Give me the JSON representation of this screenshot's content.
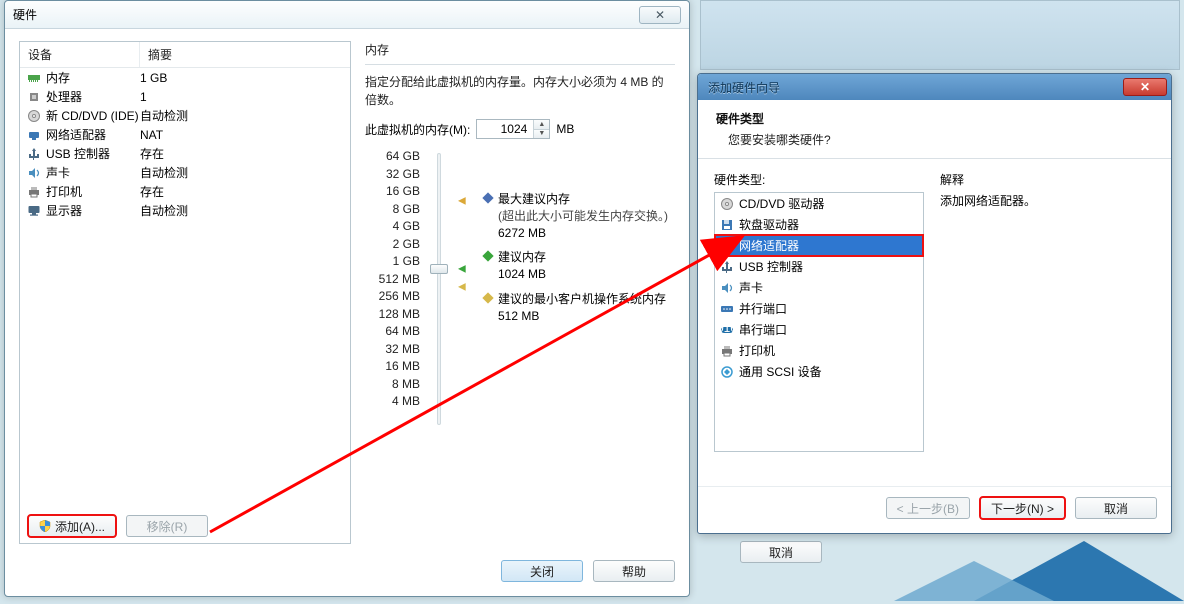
{
  "win1": {
    "title": "硬件",
    "close_x": "✕",
    "columns": {
      "device": "设备",
      "summary": "摘要"
    },
    "rows": [
      {
        "icon": "memory-icon",
        "dev": "内存",
        "sum": "1 GB"
      },
      {
        "icon": "cpu-icon",
        "dev": "处理器",
        "sum": "1"
      },
      {
        "icon": "cd-icon",
        "dev": "新 CD/DVD (IDE)",
        "sum": "自动检测"
      },
      {
        "icon": "network-icon",
        "dev": "网络适配器",
        "sum": "NAT"
      },
      {
        "icon": "usb-icon",
        "dev": "USB 控制器",
        "sum": "存在"
      },
      {
        "icon": "sound-icon",
        "dev": "声卡",
        "sum": "自动检测"
      },
      {
        "icon": "printer-icon",
        "dev": "打印机",
        "sum": "存在"
      },
      {
        "icon": "display-icon",
        "dev": "显示器",
        "sum": "自动检测"
      }
    ],
    "add_btn": "添加(A)...",
    "remove_btn": "移除(R)",
    "right": {
      "section": "内存",
      "desc": "指定分配给此虚拟机的内存量。内存大小必须为 4 MB 的倍数。",
      "field_label": "此虚拟机的内存(M):",
      "field_value": "1024",
      "field_unit": "MB",
      "ticks": [
        "64 GB",
        "32 GB",
        "16 GB",
        "8 GB",
        "4 GB",
        "2 GB",
        "1 GB",
        "512 MB",
        "256 MB",
        "128 MB",
        "64 MB",
        "32 MB",
        "16 MB",
        "8 MB",
        "4 MB"
      ],
      "legend_max_title": "最大建议内存",
      "legend_max_warn": "(超出此大小可能发生内存交换。)",
      "legend_max_val": "6272 MB",
      "legend_rec_title": "建议内存",
      "legend_rec_val": "1024 MB",
      "legend_min_title": "建议的最小客户机操作系统内存",
      "legend_min_val": "512 MB"
    },
    "footer": {
      "close": "关闭",
      "help": "帮助"
    }
  },
  "win2": {
    "title": "添加硬件向导",
    "header_bold": "硬件类型",
    "header_sub": "您要安装哪类硬件?",
    "hwtype_label": "硬件类型:",
    "explain_label": "解释",
    "explain_text": "添加网络适配器。",
    "items": [
      {
        "icon": "cd-icon",
        "label": "CD/DVD 驱动器"
      },
      {
        "icon": "floppy-icon",
        "label": "软盘驱动器"
      },
      {
        "icon": "network-icon",
        "label": "网络适配器",
        "selected": true
      },
      {
        "icon": "usb-icon",
        "label": "USB 控制器"
      },
      {
        "icon": "sound-icon",
        "label": "声卡"
      },
      {
        "icon": "parallel-icon",
        "label": "并行端口"
      },
      {
        "icon": "serial-icon",
        "label": "串行端口"
      },
      {
        "icon": "printer-icon",
        "label": "打印机"
      },
      {
        "icon": "scsi-icon",
        "label": "通用 SCSI 设备"
      }
    ],
    "footer": {
      "back": "< 上一步(B)",
      "next": "下一步(N) >",
      "cancel": "取消"
    }
  },
  "behind": {
    "cancel": "取消"
  },
  "colors": {
    "selection": "#2e77d0",
    "annotation": "#ff0000",
    "marker_max": "#dba838",
    "marker_rec": "#39a53b",
    "marker_min": "#d6b84a"
  }
}
